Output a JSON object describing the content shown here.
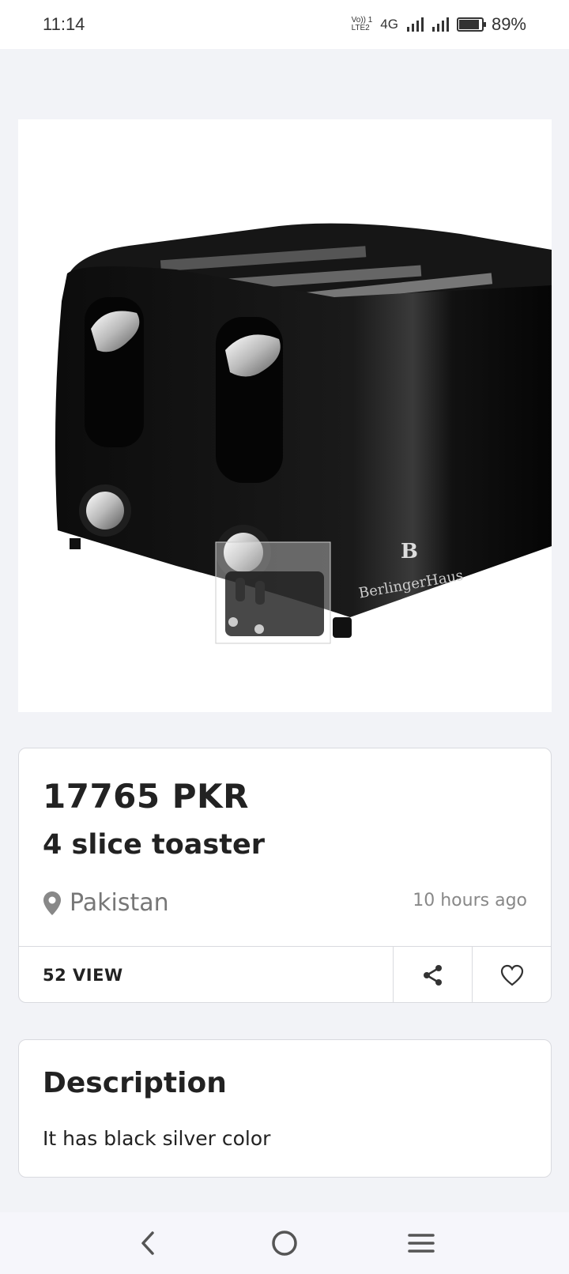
{
  "status_bar": {
    "time": "11:14",
    "volte_top": "Vo)) 1",
    "volte_bottom": "LTE2",
    "network": "4G",
    "battery_text": "89%",
    "battery_level": 0.89
  },
  "product": {
    "image_icon": "toaster-image",
    "brand_logo_text": "BerlingerHaus",
    "price": "17765 PKR",
    "title": "4 slice toaster",
    "location": "Pakistan",
    "posted": "10 hours ago",
    "views": "52 VIEW"
  },
  "description": {
    "heading": "Description",
    "text": "It has black silver color"
  },
  "icons": {
    "location": "map-pin-icon",
    "share": "share-icon",
    "favorite": "heart-icon",
    "back": "back-icon",
    "home": "home-icon",
    "menu": "menu-icon"
  },
  "colors": {
    "background": "#f2f3f7",
    "card": "#ffffff",
    "text": "#222222",
    "muted": "#777777"
  }
}
